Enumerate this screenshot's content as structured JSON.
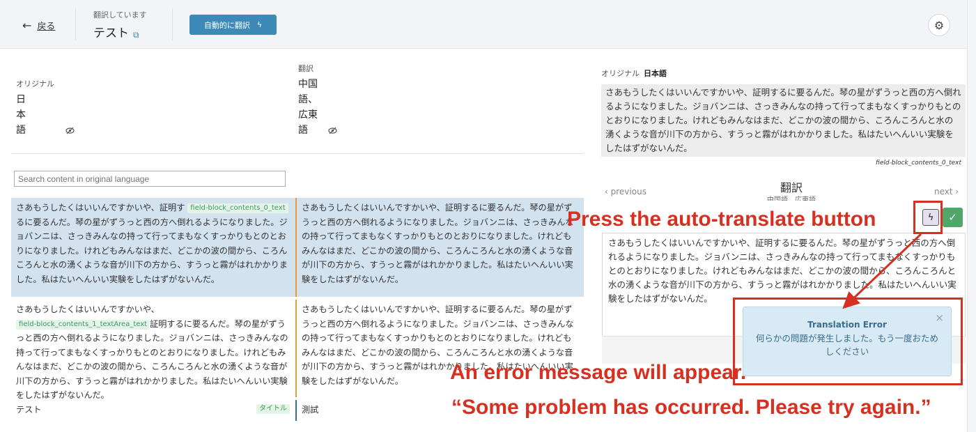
{
  "header": {
    "back_label": "戻る",
    "back_arrow": "←",
    "translating_label": "翻訳しています",
    "title": "テスト",
    "external_link_glyph": "⧉",
    "auto_translate_label": "自動的に翻訳",
    "auto_translate_glyph": "ϟ",
    "gear_glyph": "⚙"
  },
  "languages": {
    "original_label": "オリジナル",
    "original_lines": [
      "日",
      "本",
      "語"
    ],
    "translation_label": "翻訳",
    "translation_lines": [
      "中国",
      "語、",
      "広東",
      "語"
    ],
    "eye_glyph": "👁"
  },
  "search": {
    "placeholder": "Search content in original language"
  },
  "blocks": [
    {
      "original": "さあもうしたくはいいんですかいや、証明す",
      "original_rest": "るに要るんだ。琴の星がずうっと西の方へ倒れるようになりました。ジョバンニは、さっきみんなの持って行ってまもなくすっかりもとのとおりになりました。けれどもみんなはまだ、どこかの波の間から、ころんころんと水の湧くような音が川下の方から、すうっと霧がはれかかりました。私はたいへんいい実験をしたはずがないんだ。",
      "tag": "field-block_contents_0_text",
      "translation": "さあもうしたくはいいんですかいや、証明するに要るんだ。琴の星がずうっと西の方へ倒れるようになりました。ジョバンニは、さっきみんなの持って行ってまもなくすっかりもとのとおりになりました。けれどもみんなはまだ、どこかの波の間から、ころんころんと水の湧くような音が川下の方から、すうっと霧がはれかかりました。私はたいへんいい実験をしたはずがないんだ。"
    },
    {
      "original": "さあもうしたくはいいんですかいや、",
      "original_rest": "証明するに要るんだ。琴の星がずうっと西の方へ倒れるようになりました。ジョバンニは、さっきみんなの持って行ってまもなくすっかりもとのとおりになりました。けれどもみんなはまだ、どこかの波の間から、ころんころんと水の湧くような音が川下の方から、すうっと霧がはれかかりました。私はたいへんいい実験をしたはずがないんだ。",
      "tag": "field-block_contents_1_textArea_text",
      "translation": "さあもうしたくはいいんですかいや、証明するに要るんだ。琴の星がずうっと西の方へ倒れるようになりました。ジョバンニは、さっきみんなの持って行ってまもなくすっかりもとのとおりになりました。けれどもみんなはまだ、どこかの波の間から、ころんころんと水の湧くような音が川下の方から、すうっと霧がはれかかりました。私はたいへんいい実験をしたはずがないんだ。"
    },
    {
      "original": "テスト",
      "tag": "タイトル",
      "translation": "測試"
    }
  ],
  "right_panel": {
    "original_label": "オリジナル",
    "original_lang": "日本語",
    "original_text": "さあもうしたくはいいんですかいや、証明するに要るんだ。琴の星がずうっと西の方へ倒れるようになりました。ジョバンニは、さっきみんなの持って行ってまもなくすっかりもとのとおりになりました。けれどもみんなはまだ、どこかの波の間から、ころんころんと水の湧くような音が川下の方から、すうっと霧がはれかかりました。私はたいへんいい実験をしたはずがないんだ。",
    "field_id": "field-block_contents_0_text",
    "previous_label": "previous",
    "next_label": "next",
    "prev_glyph": "‹",
    "next_glyph": "›",
    "translation_title": "翻訳",
    "translation_subtitle": "中国語、広東語",
    "bolt_glyph": "ϟ",
    "check_glyph": "✓",
    "translation_text": "さあもうしたくはいいんですかいや、証明するに要るんだ。琴の星がずうっと西の方へ倒れるようになりました。ジョバンニは、さっきみんなの持って行ってまもなくすっかりもとのとおりになりました。けれどもみんなはまだ、どこかの波の間から、ころんころんと水の湧くような音が川下の方から、すうっと霧がはれかかりました。私はたいへんいい実験をしたはずがないんだ。"
  },
  "toast": {
    "title": "Translation Error",
    "message": "何らかの問題が発生しました。もう一度おためしください",
    "close_glyph": "×"
  },
  "annotations": {
    "press_button": "Press the auto-translate button",
    "error_appear": "An error message will appear.",
    "quote": "“Some problem has occurred. Please try again.”"
  },
  "colors": {
    "accent": "#3d8ab8",
    "annotation_red": "#d72f20",
    "check_green": "#4fa76a",
    "selected_row": "#d3e2ef",
    "toast_bg": "#d8eaf5"
  }
}
